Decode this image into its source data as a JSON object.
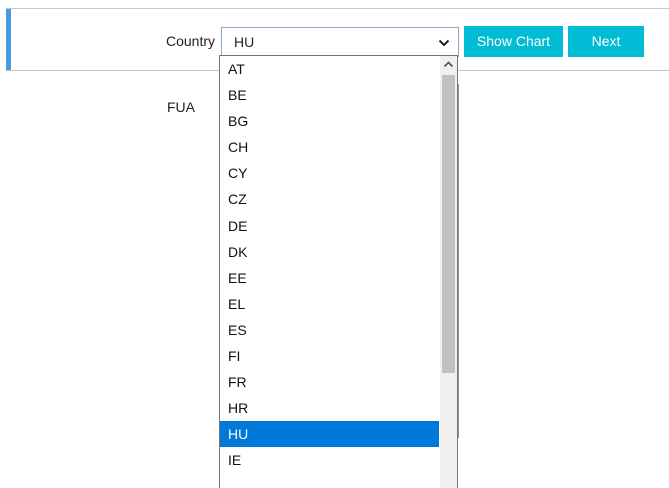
{
  "form": {
    "country_label": "Country",
    "country_value": "HU",
    "fua_label": "FUA",
    "show_chart_label": "Show Chart",
    "next_label": "Next"
  },
  "dropdown": {
    "options": [
      "AT",
      "BE",
      "BG",
      "CH",
      "CY",
      "CZ",
      "DE",
      "DK",
      "EE",
      "EL",
      "ES",
      "FI",
      "FR",
      "HR",
      "HU",
      "IE"
    ],
    "selected": "HU"
  },
  "colors": {
    "accent": "#4a9ae2",
    "button": "#00bcd4",
    "selection": "#0078d7"
  },
  "icons": {
    "select_arrow": "chevron-down-icon",
    "scroll_up": "chevron-up-icon"
  }
}
